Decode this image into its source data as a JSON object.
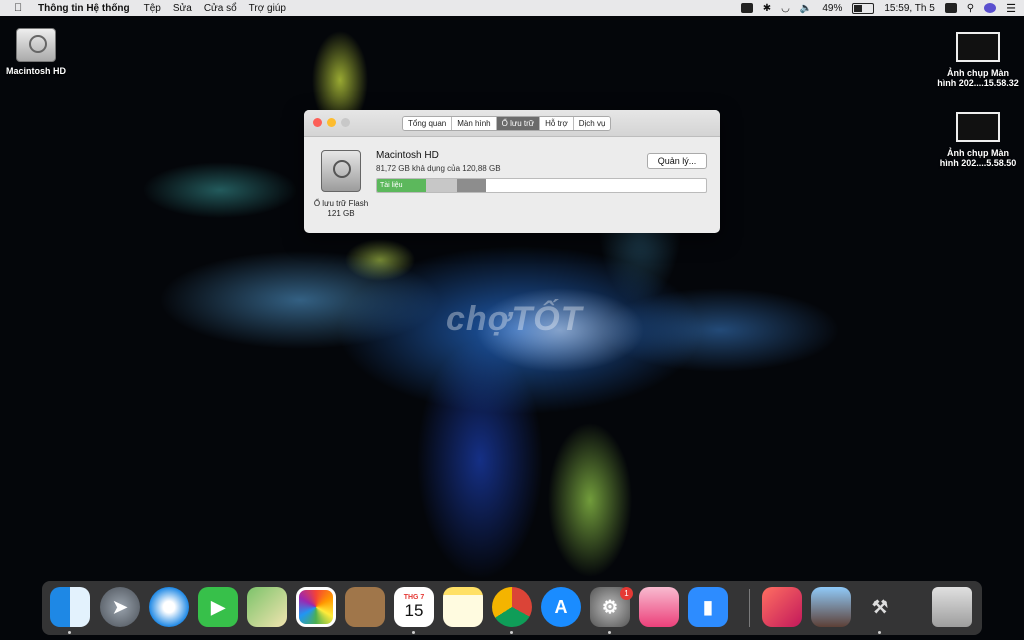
{
  "menubar": {
    "app_name": "Thông tin Hệ thống",
    "menus": [
      "Tệp",
      "Sửa",
      "Cửa sổ",
      "Trợ giúp"
    ],
    "battery": "49%",
    "clock": "15:59, Th 5"
  },
  "desktop": {
    "drive_label": "Macintosh HD",
    "screenshots": [
      {
        "line1": "Ảnh chụp Màn",
        "line2": "hình 202....15.58.32"
      },
      {
        "line1": "Ảnh chụp Màn",
        "line2": "hình 202....5.58.50"
      }
    ]
  },
  "window": {
    "tabs": [
      "Tổng quan",
      "Màn hình",
      "Ổ lưu trữ",
      "Hỗ trợ",
      "Dịch vụ"
    ],
    "active_tab": "Ổ lưu trữ",
    "disk_type": "Ổ lưu trữ Flash",
    "disk_size": "121 GB",
    "volume_name": "Macintosh HD",
    "volume_info": "81,72 GB khả dụng của 120,88 GB",
    "manage_label": "Quản lý...",
    "storage": {
      "segments": [
        {
          "label": "Tài liệu",
          "fraction": 0.148,
          "color": "#5cb85c"
        },
        {
          "label": "",
          "fraction": 0.095,
          "color": "#c7c7c7"
        },
        {
          "label": "",
          "fraction": 0.087,
          "color": "#8d8d8d"
        }
      ],
      "used_fraction": 0.324
    }
  },
  "watermark": "chợTỐT",
  "dock": {
    "apps": [
      "Finder",
      "Launchpad",
      "Safari",
      "FaceTime",
      "Maps",
      "Photos",
      "Contacts",
      "Calendar",
      "Notes",
      "Chrome",
      "App Store",
      "System Preferences",
      "CleanMyMac",
      "Zoom",
      "Creative Cloud",
      "Preview",
      "Utility",
      "Trash"
    ],
    "calendar_month": "THG 7",
    "calendar_day": "15",
    "sysprefs_badge": "1"
  }
}
